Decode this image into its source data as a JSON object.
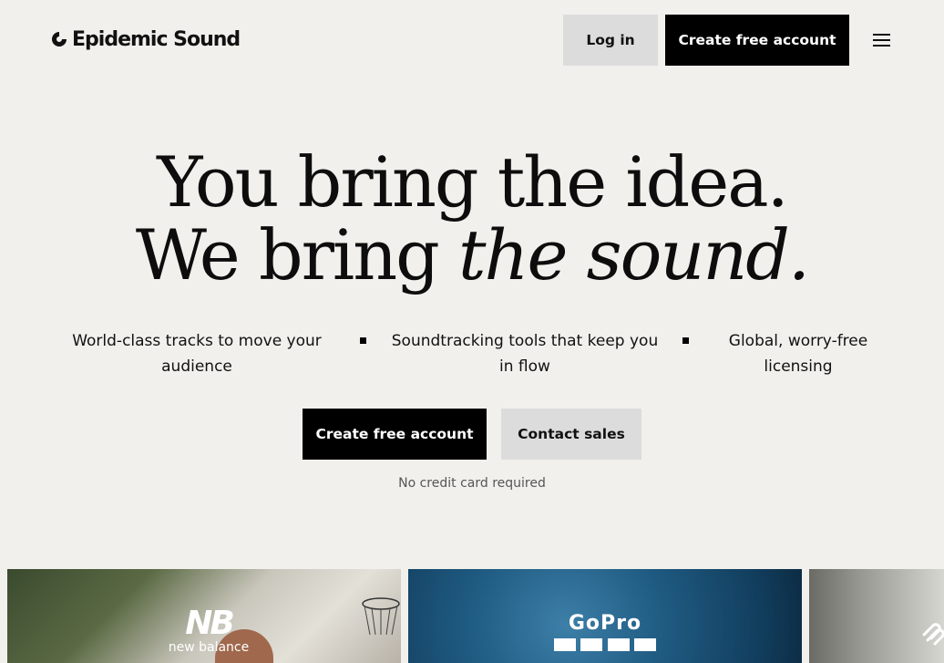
{
  "header": {
    "logo_text": "Epidemic Sound",
    "login_label": "Log in",
    "create_account_label": "Create free account",
    "menu_icon": "hamburger-menu-icon"
  },
  "hero": {
    "headline_line1": "You bring the idea.",
    "headline_line2_plain": "We bring ",
    "headline_line2_italic": "the sound.",
    "features": [
      "World-class tracks to move your audience",
      "Soundtracking tools that keep you in flow",
      "Global, worry-free licensing"
    ],
    "primary_cta": "Create free account",
    "secondary_cta": "Contact sales",
    "note": "No credit card required"
  },
  "cards": [
    {
      "brand": "new balance",
      "icon": "new-balance-logo"
    },
    {
      "brand": "GoPro",
      "icon": "gopro-logo"
    },
    {
      "brand": "",
      "icon": "squarespace-logo"
    }
  ],
  "colors": {
    "background": "#f1f0ec",
    "primary_button": "#000000",
    "secondary_button": "#dcdcdc"
  }
}
